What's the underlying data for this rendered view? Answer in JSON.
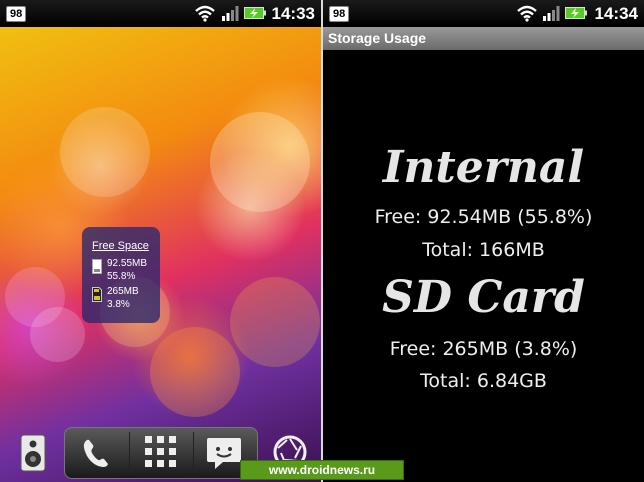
{
  "left_phone": {
    "status_bar": {
      "notification_count": "98",
      "time": "14:33",
      "icons": [
        "wifi-icon",
        "signal-icon",
        "battery-charging-icon"
      ]
    },
    "widget": {
      "title": "Free Space",
      "internal": {
        "free": "92.55MB",
        "percent": "55.8%",
        "icon": "phone-memory-icon"
      },
      "sd_card": {
        "free": "265MB",
        "percent": "3.8%",
        "icon": "sd-card-icon"
      }
    },
    "dock": {
      "items": [
        "phone-icon",
        "app-grid-icon",
        "messages-icon"
      ]
    },
    "side_buttons": [
      "speaker-icon",
      "camera-icon"
    ]
  },
  "right_phone": {
    "status_bar": {
      "notification_count": "98",
      "time": "14:34",
      "icons": [
        "wifi-icon",
        "signal-icon",
        "battery-charging-icon"
      ]
    },
    "title": "Storage Usage",
    "internal": {
      "heading": "Internal",
      "free": "Free: 92.54MB (55.8%)",
      "total": "Total: 166MB"
    },
    "sd_card": {
      "heading": "SD Card",
      "free": "Free: 265MB (3.8%)",
      "total": "Total: 6.84GB"
    }
  },
  "watermark": "www.droidnews.ru",
  "colors": {
    "widget_bg": "#28286e",
    "title_bar": "#8a8a8a",
    "battery": "#55cc22",
    "watermark_bg": "#5a9a1a"
  }
}
